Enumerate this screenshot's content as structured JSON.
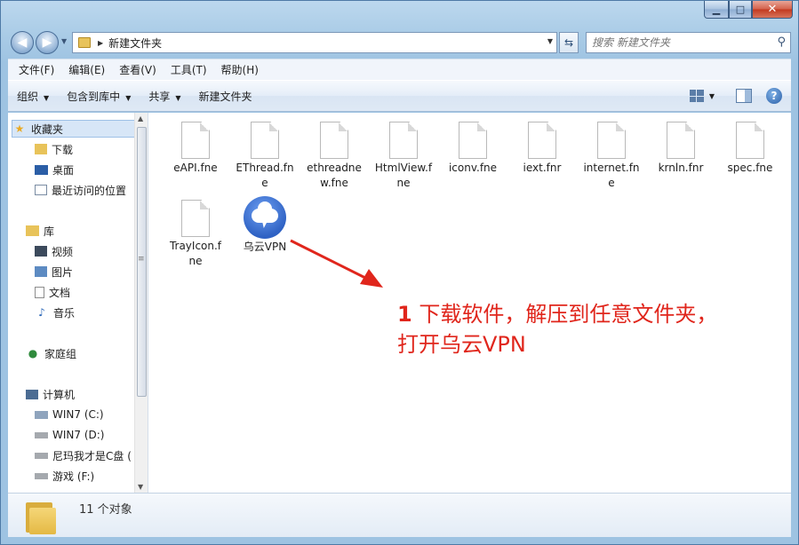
{
  "window": {
    "caption": {
      "minimize": "▁",
      "maximize": "□",
      "close": "✕"
    }
  },
  "address": {
    "path": "新建文件夹",
    "search_placeholder": "搜索 新建文件夹"
  },
  "menu": [
    "文件(F)",
    "编辑(E)",
    "查看(V)",
    "工具(T)",
    "帮助(H)"
  ],
  "toolbar": {
    "organize": "组织",
    "include_library": "包含到库中",
    "share": "共享",
    "new_folder": "新建文件夹"
  },
  "nav": {
    "favorites": "收藏夹",
    "downloads": "下载",
    "desktop": "桌面",
    "recent": "最近访问的位置",
    "libraries": "库",
    "videos": "视频",
    "pictures": "图片",
    "documents": "文档",
    "music": "音乐",
    "homegroup": "家庭组",
    "computer": "计算机",
    "drive_c": "WIN7 (C:)",
    "drive_d": "WIN7 (D:)",
    "drive_e": "尼玛我才是C盘 (",
    "drive_f": "游戏 (F:)"
  },
  "files": [
    {
      "line1": "eAPI.fne",
      "line2": ""
    },
    {
      "line1": "EThread.fn",
      "line2": "e"
    },
    {
      "line1": "ethreadne",
      "line2": "w.fne"
    },
    {
      "line1": "HtmlView.f",
      "line2": "ne"
    },
    {
      "line1": "iconv.fne",
      "line2": ""
    },
    {
      "line1": "iext.fnr",
      "line2": ""
    },
    {
      "line1": "internet.fn",
      "line2": "e"
    },
    {
      "line1": "krnln.fnr",
      "line2": ""
    },
    {
      "line1": "spec.fne",
      "line2": ""
    },
    {
      "line1": "TrayIcon.f",
      "line2": "ne"
    },
    {
      "line1": "乌云VPN",
      "line2": ""
    }
  ],
  "annotation": {
    "number": "1",
    "line1": "下载软件，解压到任意文件夹，",
    "line2": "打开乌云VPN",
    "color": "#e0261c"
  },
  "details": {
    "count_text": "11 个对象"
  },
  "icons": {
    "back": "back-arrow-icon",
    "forward": "forward-arrow-icon",
    "refresh": "refresh-icon",
    "search": "search-icon",
    "help": "help-icon"
  }
}
